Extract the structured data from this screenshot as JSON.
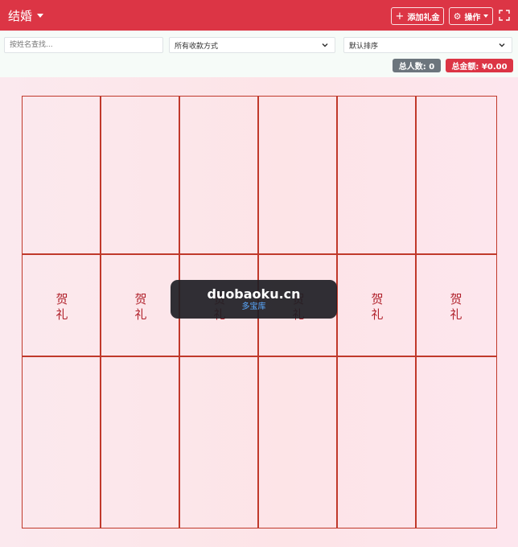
{
  "header": {
    "title": "结婚",
    "add_label": "添加礼金",
    "ops_label": "操作",
    "bg_color": "#dc3545"
  },
  "filters": {
    "search_placeholder": "按姓名查找...",
    "payment_select": "所有收款方式",
    "sort_select": "默认排序"
  },
  "summary": {
    "count_label": "总人数: 0",
    "total_label": "总金额: ¥0.00"
  },
  "gift_book": {
    "columns": 6,
    "cells": [
      [
        "贺",
        "礼"
      ],
      [
        "贺",
        "礼"
      ],
      [
        "贺",
        "礼"
      ],
      [
        "贺",
        "礼"
      ],
      [
        "贺",
        "礼"
      ],
      [
        "贺",
        "礼"
      ]
    ],
    "line_color": "#c0392b"
  },
  "watermark": {
    "main": "duobaoku.cn",
    "sub": "多宝库"
  },
  "icons": [
    "caret-down-icon",
    "plus-icon",
    "gear-icon",
    "caret-down-icon",
    "fullscreen-icon",
    "chevron-down-icon"
  ]
}
